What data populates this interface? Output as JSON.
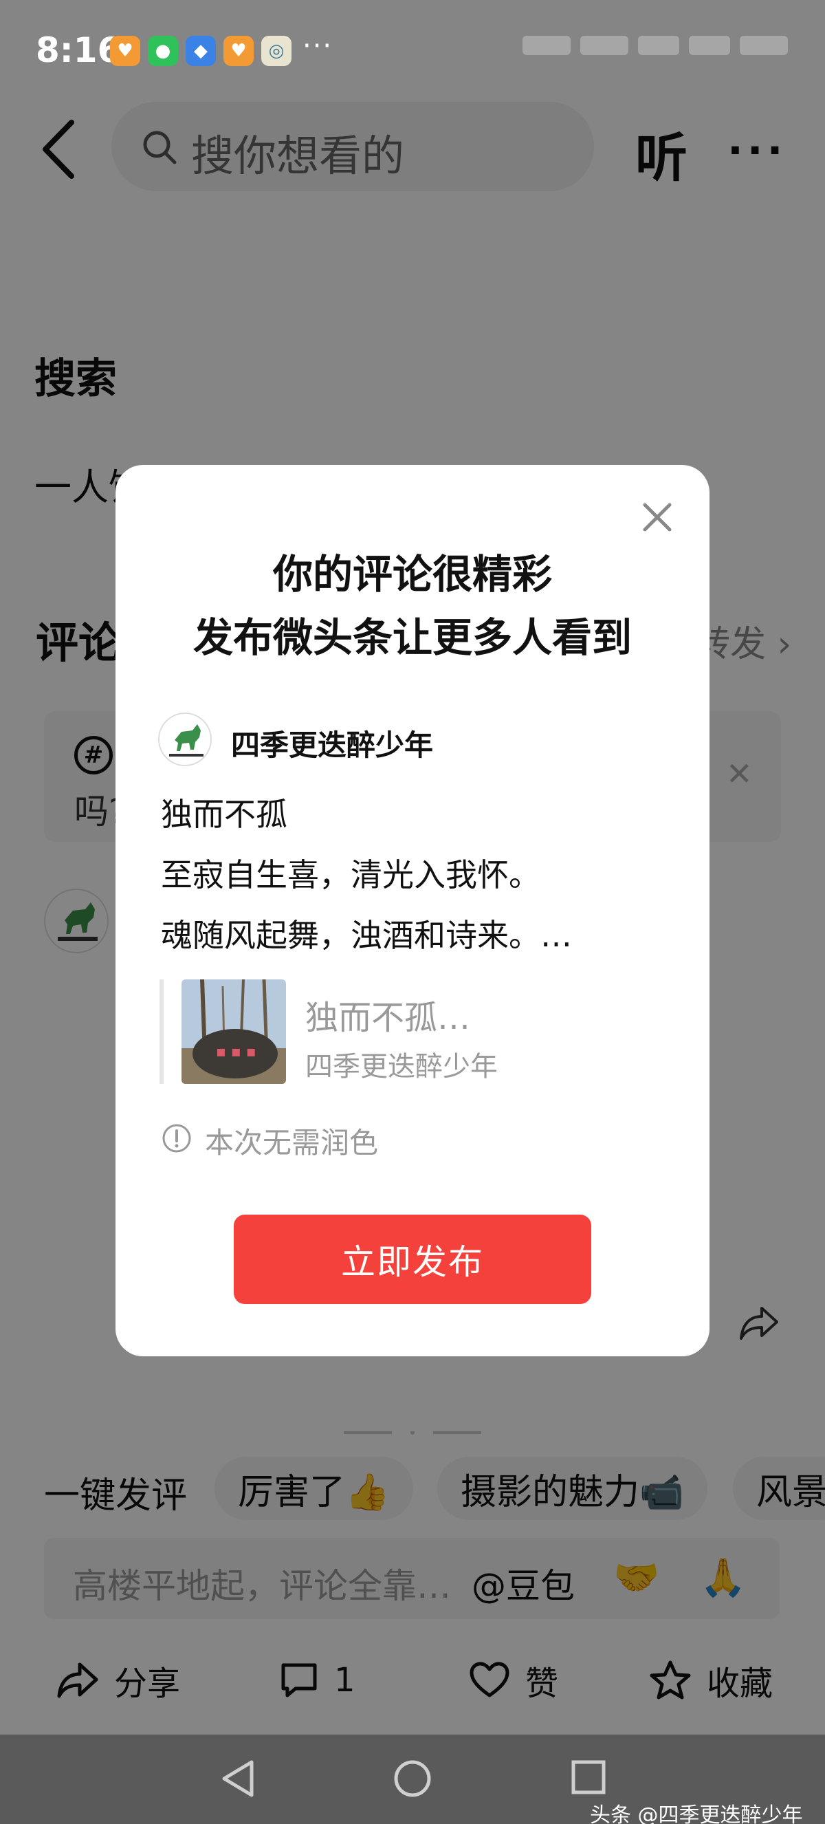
{
  "status_bar": {
    "time": "8:16",
    "more": "···",
    "app_icons": [
      {
        "name": "heart-app-icon",
        "color": "#f39a35",
        "glyph": "♥"
      },
      {
        "name": "wechat-icon",
        "color": "#2fc25b",
        "glyph": "●"
      },
      {
        "name": "blue-app-icon",
        "color": "#3b82e6",
        "glyph": "◆"
      },
      {
        "name": "heart-app-icon-2",
        "color": "#f39a35",
        "glyph": "♥"
      },
      {
        "name": "yoyo-app-icon",
        "color": "#e8e4d0",
        "glyph": "◎"
      }
    ]
  },
  "top_nav": {
    "search_placeholder": "搜你想看的",
    "listen_label": "听",
    "more_label": "···"
  },
  "background": {
    "section_title": "搜索",
    "section_text": "一人饮酒醉独自一人 深夜醉酒情诗",
    "comment_label": "评论",
    "repost_label": "转发",
    "topic_text": "吗?"
  },
  "quick_comment": {
    "label": "一键发评",
    "chips": [
      "厉害了👍",
      "摄影的魅力📹",
      "风景"
    ]
  },
  "comment_input": {
    "placeholder": "高楼平地起，评论全靠…",
    "mention": "@豆包",
    "emojis": [
      "🤝",
      "🙏"
    ]
  },
  "bottom_bar": {
    "share": "分享",
    "comments": "1",
    "like": "赞",
    "favorite": "收藏"
  },
  "watermark": "头条 @四季更迭醉少年",
  "modal": {
    "title_line1": "你的评论很精彩",
    "title_line2": "发布微头条让更多人看到",
    "author_name": "四季更迭醉少年",
    "post_lines": [
      "独而不孤",
      "至寂自生喜，清光入我怀。",
      "魂随风起舞，浊酒和诗来。…"
    ],
    "quote_title": "独而不孤…",
    "quote_author": "四季更迭醉少年",
    "notice": "本次无需润色",
    "publish_label": "立即发布"
  },
  "colors": {
    "accent_red": "#f5413c",
    "overlay": "rgba(0,0,0,0.48)"
  }
}
